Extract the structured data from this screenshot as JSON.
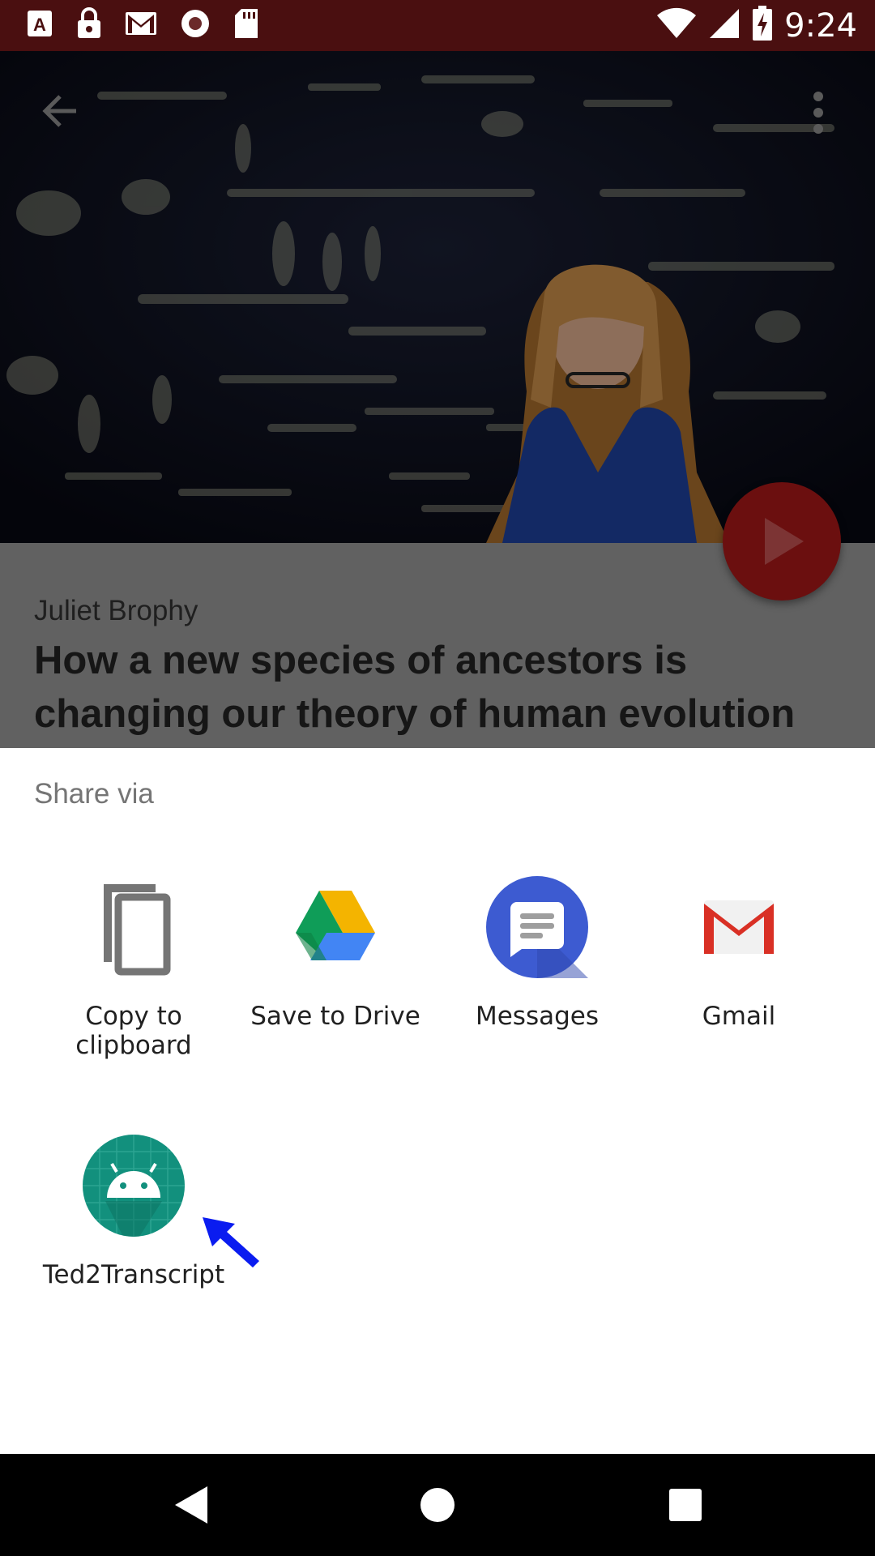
{
  "status_bar": {
    "time": "9:24",
    "left_icons": [
      "a-icon",
      "lock-icon",
      "gmail-icon",
      "record-icon",
      "sdcard-icon"
    ],
    "right_icons": [
      "wifi-icon",
      "signal-icon",
      "battery-charging-icon"
    ],
    "background": "#4a0f10"
  },
  "hero": {
    "back_icon": "back-arrow-icon",
    "more_icon": "more-vert-icon",
    "play_icon": "play-icon",
    "play_color": "#6b0f0f"
  },
  "talk": {
    "speaker": "Juliet Brophy",
    "title": "How a new species of ancestors is changing our theory of human evolution"
  },
  "share_sheet": {
    "title": "Share via",
    "apps": [
      {
        "label": "Copy to clipboard",
        "icon": "copy-icon"
      },
      {
        "label": "Save to Drive",
        "icon": "google-drive-icon"
      },
      {
        "label": "Messages",
        "icon": "messages-icon"
      },
      {
        "label": "Gmail",
        "icon": "gmail-icon"
      },
      {
        "label": "Ted2Transcript",
        "icon": "android-icon"
      }
    ],
    "annotation_arrow_color": "#0a1cf0"
  },
  "nav_bar": {
    "icons": [
      "back-triangle-icon",
      "home-circle-icon",
      "recents-square-icon"
    ]
  }
}
